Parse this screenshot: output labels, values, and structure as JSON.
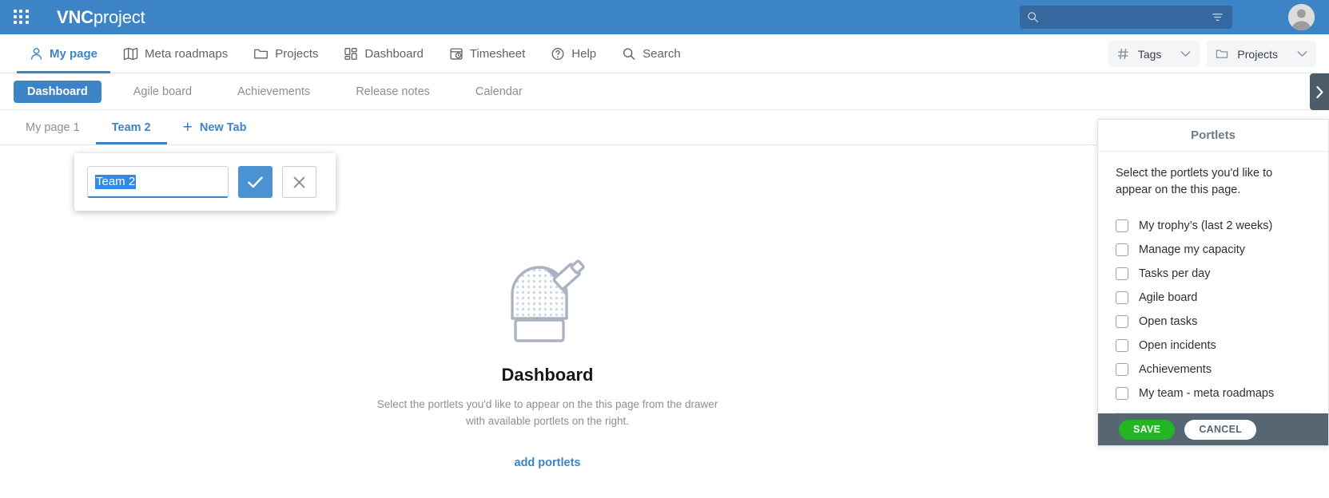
{
  "header": {
    "brand_bold": "VNC",
    "brand_light": "project",
    "apps_icon": "apps-grid-icon",
    "search": {
      "value": "",
      "placeholder": "",
      "icon": "search-icon",
      "filter_icon": "filter-icon"
    },
    "avatar_icon": "user-avatar"
  },
  "mainnav": {
    "items": [
      {
        "label": "My page",
        "icon": "person-icon",
        "active": true
      },
      {
        "label": "Meta roadmaps",
        "icon": "map-icon",
        "active": false
      },
      {
        "label": "Projects",
        "icon": "folder-icon",
        "active": false
      },
      {
        "label": "Dashboard",
        "icon": "grid-icon",
        "active": false
      },
      {
        "label": "Timesheet",
        "icon": "timesheet-icon",
        "active": false
      },
      {
        "label": "Help",
        "icon": "help-icon",
        "active": false
      },
      {
        "label": "Search",
        "icon": "search-icon",
        "active": false
      }
    ],
    "selects": [
      {
        "label": "Tags",
        "icon": "hash-icon",
        "chevron": "chevron-down-icon"
      },
      {
        "label": "Projects",
        "icon": "folder-icon",
        "chevron": "chevron-down-icon"
      }
    ]
  },
  "subnav": {
    "tabs": [
      {
        "label": "Dashboard",
        "active": true
      },
      {
        "label": "Agile board",
        "active": false
      },
      {
        "label": "Achievements",
        "active": false
      },
      {
        "label": "Release notes",
        "active": false
      },
      {
        "label": "Calendar",
        "active": false
      }
    ]
  },
  "pagetabs": {
    "tabs": [
      {
        "label": "My page 1",
        "active": false
      },
      {
        "label": "Team 2",
        "active": true
      }
    ],
    "new_tab_label": "New Tab",
    "new_tab_plus": "+"
  },
  "rename_popup": {
    "input_value": "Team 2",
    "input_placeholder": "",
    "confirm_icon": "check-icon",
    "cancel_icon": "close-icon",
    "selection_highlight_color": "#2f8ae8"
  },
  "empty_state": {
    "illustration": "observatory-telescope-icon",
    "title": "Dashboard",
    "description": "Select the portlets you'd like to appear on the this page from the drawer with available portlets on the right.",
    "link_label": "add portlets"
  },
  "drawer": {
    "tab_icon": "chevron-right-icon",
    "title": "Portlets",
    "intro": "Select the portlets you'd like to appear on the this page.",
    "portlets": [
      {
        "label": "My trophy’s (last 2 weeks)",
        "checked": false
      },
      {
        "label": "Manage my capacity",
        "checked": false
      },
      {
        "label": "Tasks per day",
        "checked": false
      },
      {
        "label": "Agile board",
        "checked": false
      },
      {
        "label": "Open tasks",
        "checked": false
      },
      {
        "label": "Open incidents",
        "checked": false
      },
      {
        "label": "Achievements",
        "checked": false
      },
      {
        "label": "My team - meta roadmaps",
        "checked": false
      }
    ],
    "save_label": "SAVE",
    "cancel_label": "CANCEL"
  },
  "colors": {
    "brand_blue": "#3d84c6",
    "search_blue": "#34689e",
    "save_green": "#23b523",
    "drawer_slate": "#566673",
    "tab_slate": "#4e5c68"
  }
}
